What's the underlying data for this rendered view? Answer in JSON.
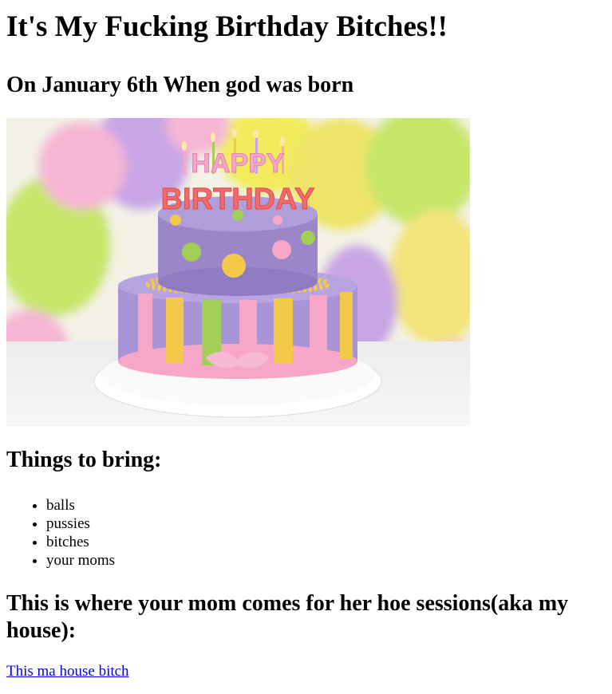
{
  "page": {
    "title": "It's My Fucking Birthday Bitches!!",
    "subtitle": "On January 6th When god was born"
  },
  "hero_image": {
    "alt": "Happy Birthday cake with balloons",
    "cake_topper_line1": "HAPPY",
    "cake_topper_line2": "BIRTHDAY",
    "colors": {
      "cake_top": "#9a86c9",
      "stripe_yellow": "#f3c94c",
      "stripe_green": "#a3cf59",
      "stripe_pink": "#f6a7c7",
      "balloon_yellow": "#f2ec5d",
      "balloon_lime": "#c6e66b",
      "balloon_pink": "#f6b6d4",
      "balloon_purple": "#c7a5e6"
    }
  },
  "bring": {
    "heading": "Things to bring:",
    "items": [
      "balls",
      "pussies",
      "bitches",
      "your moms"
    ]
  },
  "where": {
    "heading": "This is where your mom comes for her hoe sessions(aka my house):",
    "link_text": "This ma house bitch"
  }
}
